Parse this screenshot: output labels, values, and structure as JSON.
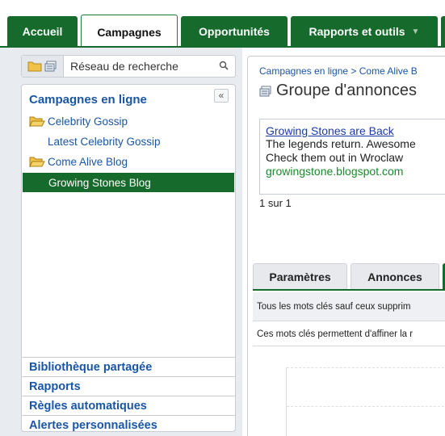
{
  "nav": {
    "tabs": [
      {
        "label": "Accueil"
      },
      {
        "label": "Campagnes"
      },
      {
        "label": "Opportunités"
      },
      {
        "label": "Rapports et outils",
        "caret": "▼"
      }
    ]
  },
  "sidebar": {
    "search": {
      "value": "Réseau de recherche",
      "icon": "search-icon"
    },
    "tree": {
      "title": "Campagnes en ligne",
      "collapse_label": "«",
      "items": [
        {
          "label": "Celebrity Gossip",
          "type": "campaign"
        },
        {
          "label": "Latest Celebrity Gossip",
          "type": "adgroup"
        },
        {
          "label": "Come Alive Blog",
          "type": "campaign"
        },
        {
          "label": "Growing Stones Blog",
          "type": "adgroup",
          "selected": true
        }
      ]
    },
    "links": [
      {
        "label": "Bibliothèque partagée"
      },
      {
        "label": "Rapports"
      },
      {
        "label": "Règles automatiques"
      },
      {
        "label": "Alertes personnalisées"
      }
    ]
  },
  "main": {
    "breadcrumb": "Campagnes en ligne > Come Alive B",
    "title": "Groupe d'annonces",
    "ad": {
      "headline": "Growing Stones are Back",
      "line1": "The legends return. Awesome",
      "line2": "Check them out in Wroclaw",
      "display_url": "growingstone.blogspot.com"
    },
    "pager": "1 sur 1",
    "tabs": [
      {
        "label": "Paramètres"
      },
      {
        "label": "Annonces"
      }
    ],
    "filter_text": "Tous les mots clés sauf ceux supprim",
    "info_text": "Ces mots clés permettent d'affiner la r"
  },
  "colors": {
    "brand_green": "#166b2c",
    "link_blue": "#1a56a6",
    "url_green": "#1a8a2a"
  }
}
